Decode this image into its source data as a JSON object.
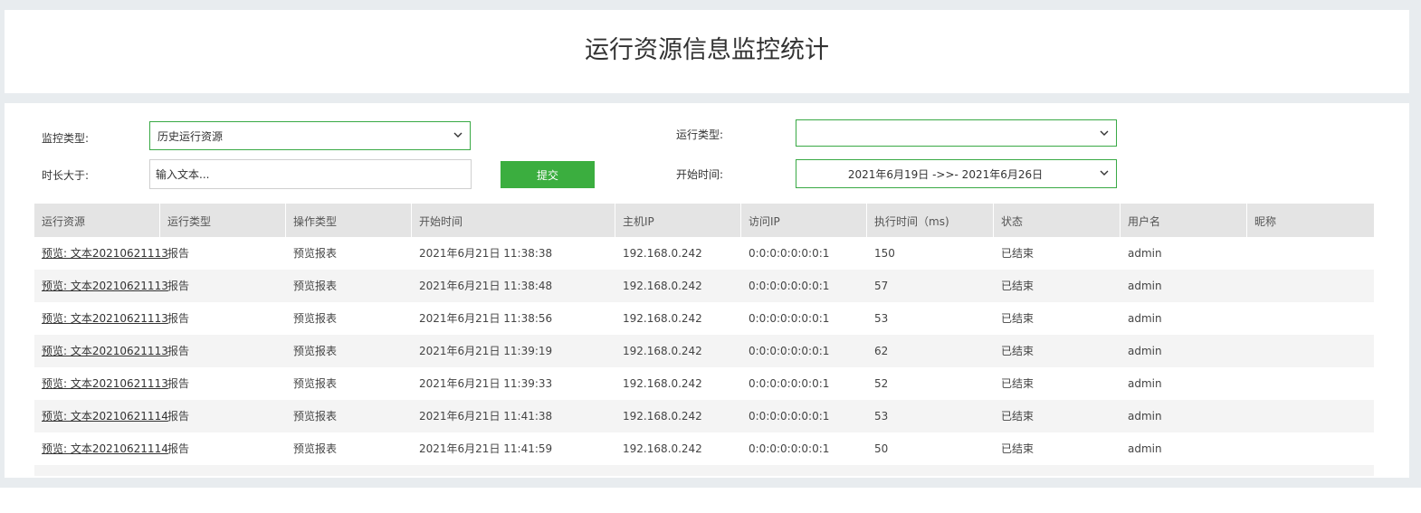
{
  "header": {
    "title": "运行资源信息监控统计"
  },
  "filters": {
    "monitor_type": {
      "label": "监控类型:",
      "value": "历史运行资源"
    },
    "run_type": {
      "label": "运行类型:",
      "value": ""
    },
    "duration": {
      "label": "时长大于:",
      "placeholder": "输入文本..."
    },
    "submit_label": "提交",
    "start_time": {
      "label": "开始时间:",
      "value": "2021年6月19日 ->>- 2021年6月26日"
    }
  },
  "table": {
    "columns": [
      "运行资源",
      "运行类型",
      "操作类型",
      "开始时间",
      "主机IP",
      "访问IP",
      "执行时间（ms)",
      "状态",
      "用户名",
      "昵称"
    ],
    "rows": [
      [
        "预览: 文本20210621113",
        "报告",
        "预览报表",
        "2021年6月21日 11:38:38",
        "192.168.0.242",
        "0:0:0:0:0:0:0:1",
        "150",
        "已结束",
        "admin",
        ""
      ],
      [
        "预览: 文本20210621113",
        "报告",
        "预览报表",
        "2021年6月21日 11:38:48",
        "192.168.0.242",
        "0:0:0:0:0:0:0:1",
        "57",
        "已结束",
        "admin",
        ""
      ],
      [
        "预览: 文本20210621113",
        "报告",
        "预览报表",
        "2021年6月21日 11:38:56",
        "192.168.0.242",
        "0:0:0:0:0:0:0:1",
        "53",
        "已结束",
        "admin",
        ""
      ],
      [
        "预览: 文本20210621113",
        "报告",
        "预览报表",
        "2021年6月21日 11:39:19",
        "192.168.0.242",
        "0:0:0:0:0:0:0:1",
        "62",
        "已结束",
        "admin",
        ""
      ],
      [
        "预览: 文本20210621113",
        "报告",
        "预览报表",
        "2021年6月21日 11:39:33",
        "192.168.0.242",
        "0:0:0:0:0:0:0:1",
        "52",
        "已结束",
        "admin",
        ""
      ],
      [
        "预览: 文本20210621114",
        "报告",
        "预览报表",
        "2021年6月21日 11:41:38",
        "192.168.0.242",
        "0:0:0:0:0:0:0:1",
        "53",
        "已结束",
        "admin",
        ""
      ],
      [
        "预览: 文本20210621114",
        "报告",
        "预览报表",
        "2021年6月21日 11:41:59",
        "192.168.0.242",
        "0:0:0:0:0:0:0:1",
        "50",
        "已结束",
        "admin",
        ""
      ]
    ]
  },
  "colors": {
    "accent": "#3bae3f",
    "border_active": "#39a945",
    "header_bg": "#e4e4e4",
    "row_alt": "#f4f4f4"
  },
  "icons": {
    "dropdown": "chevron-down-icon"
  }
}
